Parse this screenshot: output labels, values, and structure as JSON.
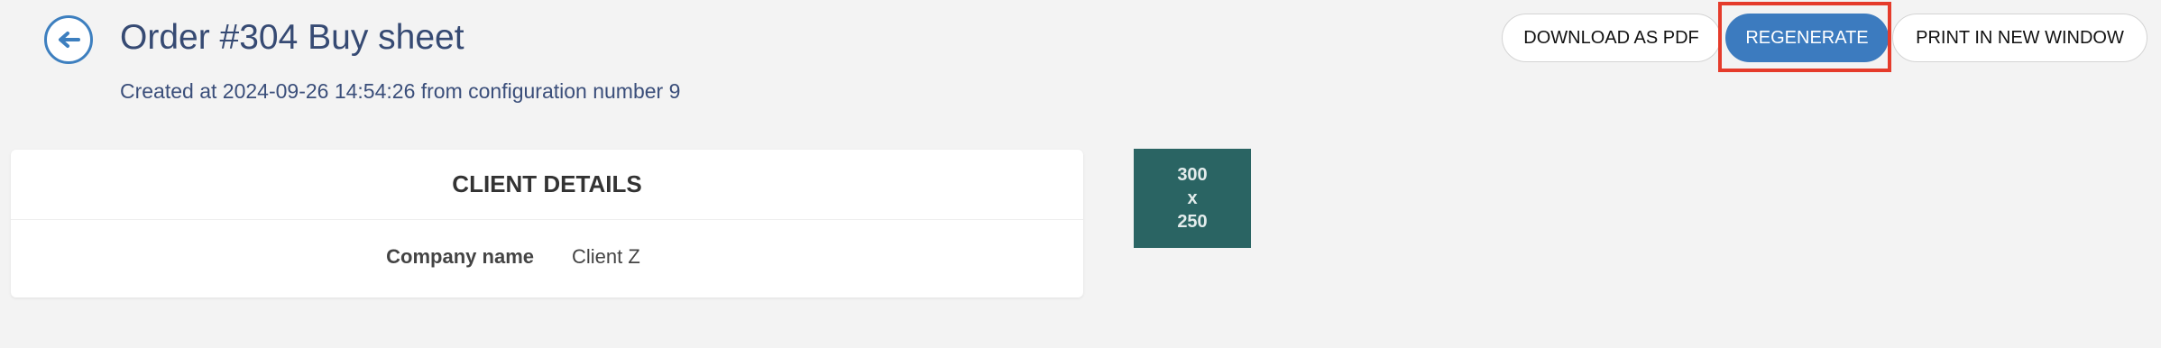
{
  "header": {
    "title": "Order #304 Buy sheet",
    "subtitle": "Created at 2024-09-26 14:54:26 from configuration number 9",
    "back_icon": "arrow-left-icon"
  },
  "toolbar": {
    "download_label": "DOWNLOAD AS PDF",
    "regenerate_label": "REGENERATE",
    "print_label": "PRINT IN NEW WINDOW",
    "accent_color": "#3c7bbf",
    "highlight_color": "#e53b2b"
  },
  "client_details": {
    "heading": "CLIENT DETAILS",
    "fields": [
      {
        "label": "Company name",
        "value": "Client Z"
      }
    ]
  },
  "ad_placeholder": {
    "width_text": "300",
    "separator": "x",
    "height_text": "250",
    "color": "#2a6463"
  }
}
